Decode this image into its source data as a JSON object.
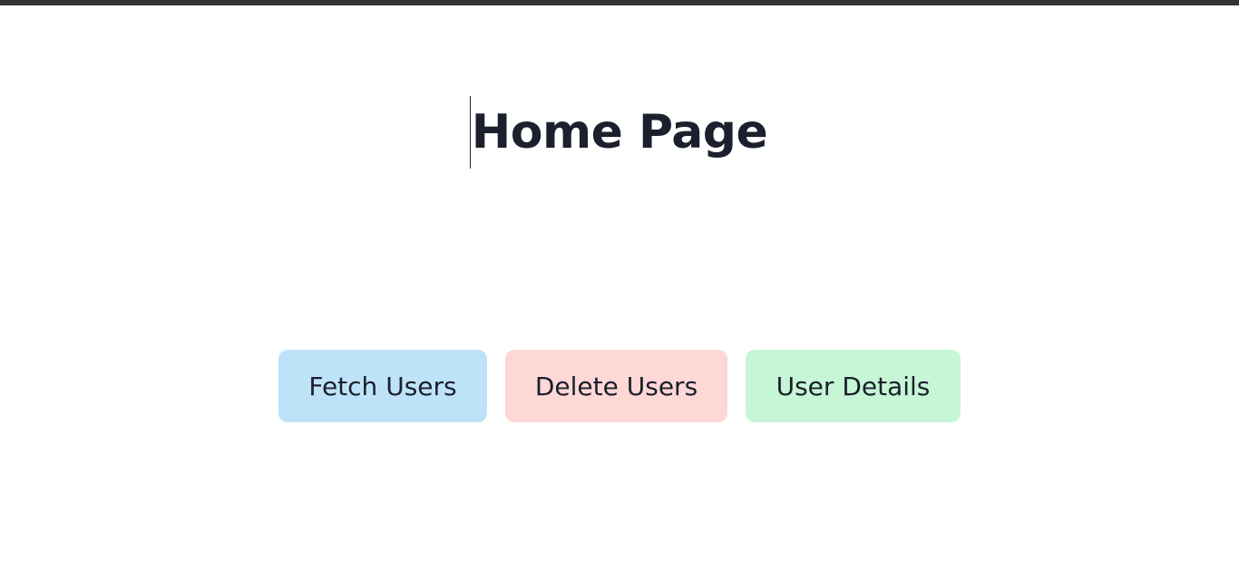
{
  "page": {
    "title": "Home Page"
  },
  "buttons": {
    "fetch_users": "Fetch Users",
    "delete_users": "Delete Users",
    "user_details": "User Details"
  },
  "colors": {
    "top_bar": "#333333",
    "title_text": "#1a202c",
    "fetch_bg": "#bee3f8",
    "delete_bg": "#fed7d7",
    "details_bg": "#c6f6d5"
  }
}
